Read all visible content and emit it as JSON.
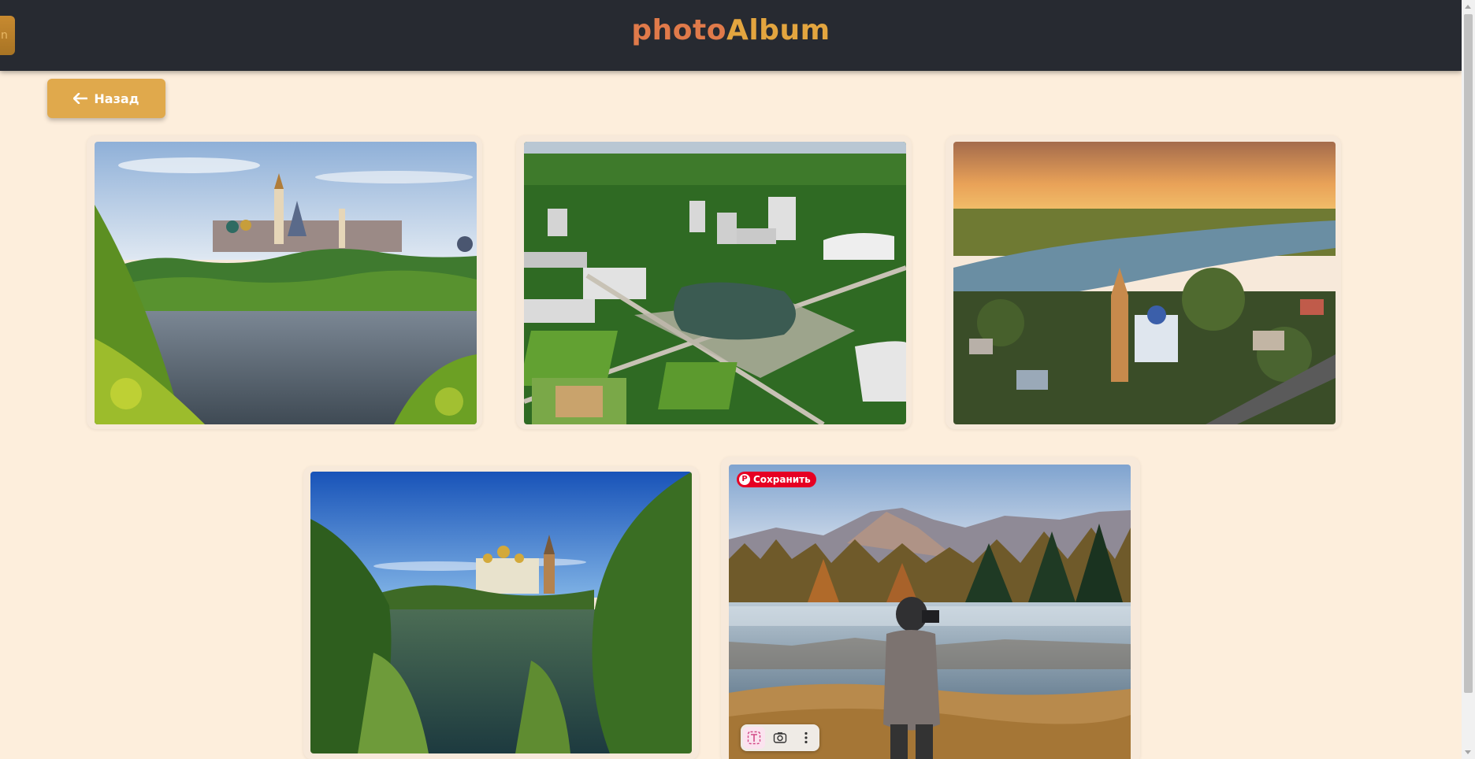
{
  "header": {
    "title_part1": "photo",
    "title_part2": "Album",
    "left_tab_text": "n"
  },
  "toolbar": {
    "back_label": "Назад"
  },
  "gallery": {
    "photos": [
      {
        "subject": "river-monastery-view"
      },
      {
        "subject": "aerial-city-park"
      },
      {
        "subject": "aerial-sunset-church"
      },
      {
        "subject": "monastery-lake-forest"
      },
      {
        "subject": "photographer-mountain-lake"
      }
    ]
  },
  "overlay": {
    "pin_save_label": "Сохранить"
  },
  "colors": {
    "header_bg": "#272a31",
    "page_bg": "#fdeedc",
    "accent": "#e0a94c",
    "title_photo": "#e07a4a",
    "title_album": "#e3a53f",
    "pinterest": "#e60023"
  }
}
